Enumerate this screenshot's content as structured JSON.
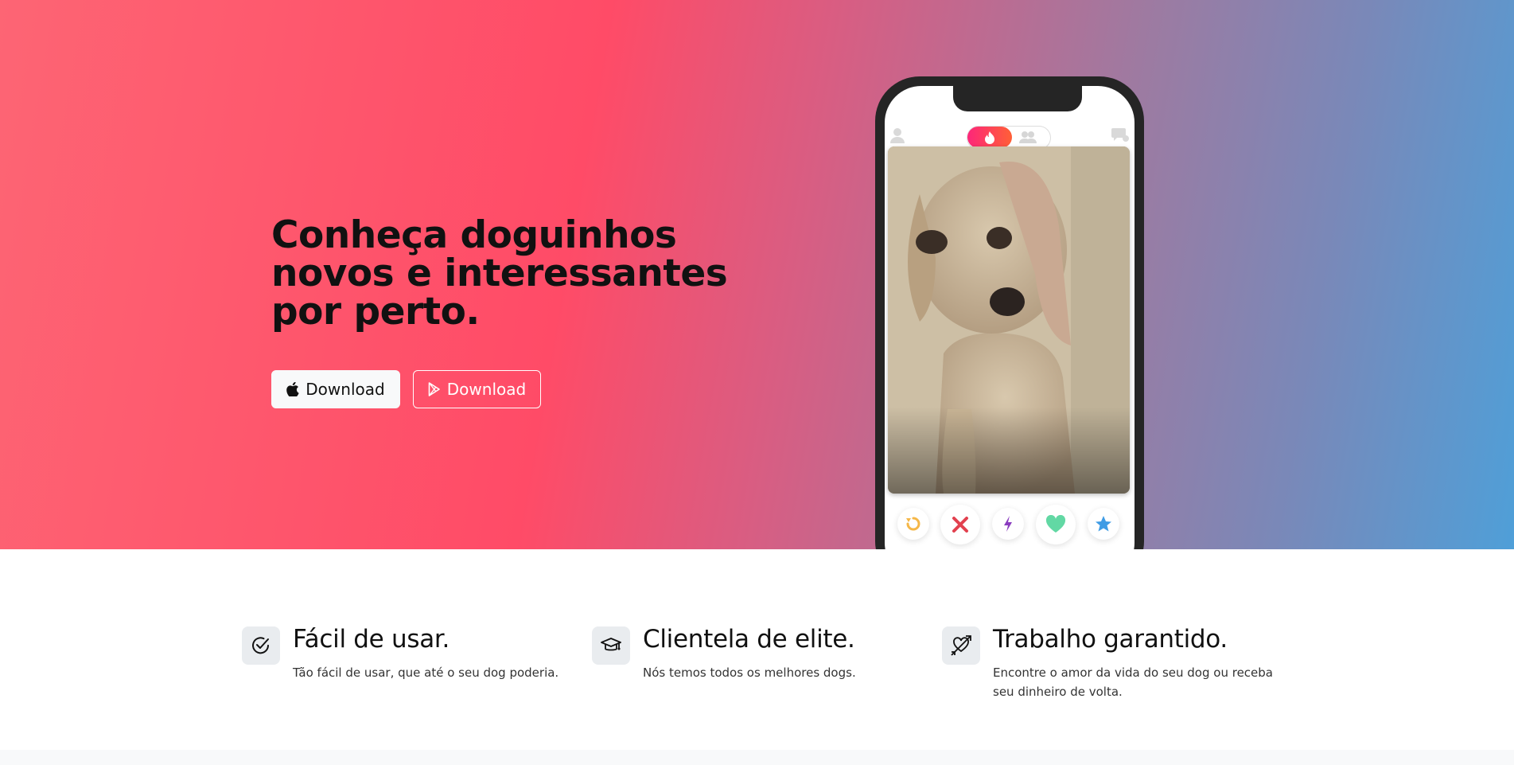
{
  "hero": {
    "headline": "Conheça doguinhos novos e interessantes por perto.",
    "apple_button_label": "Download",
    "play_button_label": "Download",
    "gradient_colors": [
      "#fd6574",
      "#ff4b67",
      "#9c7ba2",
      "#4f9fd8"
    ]
  },
  "phone": {
    "icons": {
      "profile": "user-icon",
      "chat": "chat-icon",
      "toggle_active": "flame-icon",
      "toggle_inactive": "group-icon"
    },
    "photo_subject": "dog photo",
    "actions": [
      {
        "name": "rewind",
        "icon": "rewind-icon",
        "color": "#f5b748"
      },
      {
        "name": "nope",
        "icon": "x-icon",
        "color": "#e2414f"
      },
      {
        "name": "boost",
        "icon": "bolt-icon",
        "color": "#8a3cbf"
      },
      {
        "name": "like",
        "icon": "heart-icon",
        "color": "#62d8a4"
      },
      {
        "name": "super-like",
        "icon": "star-icon",
        "color": "#3f9ce5"
      }
    ]
  },
  "features": [
    {
      "title": "Fácil de usar.",
      "text": "Tão fácil de usar, que até o seu dog poderia.",
      "icon": "check-circle-icon"
    },
    {
      "title": "Clientela de elite.",
      "text": "Nós temos todos os melhores dogs.",
      "icon": "graduation-cap-icon"
    },
    {
      "title": "Trabalho garantido.",
      "text": "Encontre o amor da vida do seu dog ou receba seu dinheiro de volta.",
      "icon": "heart-arrow-icon"
    }
  ]
}
